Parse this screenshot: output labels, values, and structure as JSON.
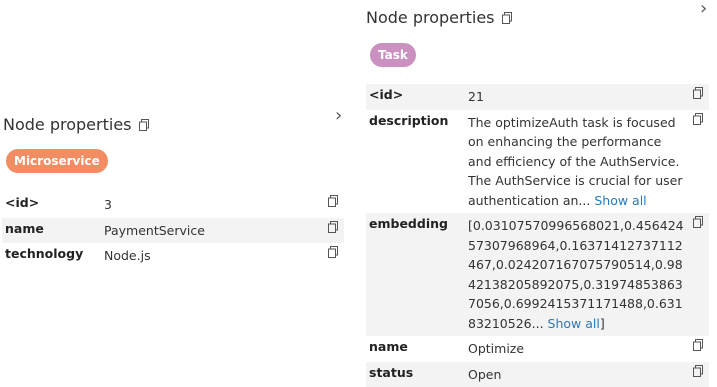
{
  "left": {
    "title": "Node properties",
    "badge": "Microservice",
    "badge_color": "#f28c62",
    "props": [
      {
        "key": "<id>",
        "value": "3"
      },
      {
        "key": "name",
        "value": "PaymentService"
      },
      {
        "key": "technology",
        "value": "Node.js"
      }
    ]
  },
  "right": {
    "title": "Node properties",
    "badge": "Task",
    "badge_color": "#c990c0",
    "id_key": "<id>",
    "id_value": "21",
    "description_key": "description",
    "description_text": "The optimizeAuth task is focused on enhancing the performance and efficiency of the AuthService. The AuthService is crucial for user authentication an...",
    "description_show_all": "Show all",
    "embedding_key": "embedding",
    "embedding_text": "[0.03107570996568021,0.45642457307968964,0.16371412737112467,0.024207167075790514,0.9842138205892075,0.319748538637056,0.6992415371171488,0.63183210526...",
    "embedding_show_all": "Show all",
    "embedding_close": "]",
    "name_key": "name",
    "name_value": "Optimize",
    "status_key": "status",
    "status_value": "Open"
  },
  "icons": {
    "copy": "copy-icon",
    "chevron": "chevron-right-icon"
  }
}
